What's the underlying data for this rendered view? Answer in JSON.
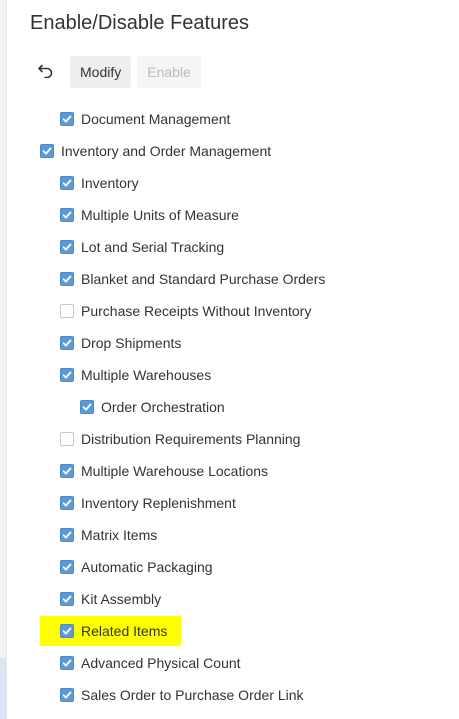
{
  "page": {
    "title": "Enable/Disable Features"
  },
  "toolbar": {
    "undo_icon": "undo-icon",
    "modify_label": "Modify",
    "enable_label": "Enable"
  },
  "colors": {
    "checkbox_checked": "#5b9bd5",
    "highlight": "#ffff00"
  },
  "features": [
    {
      "label": "Document Management",
      "checked": true,
      "level": 1
    },
    {
      "label": "Inventory and Order Management",
      "checked": true,
      "level": 0
    },
    {
      "label": "Inventory",
      "checked": true,
      "level": 1
    },
    {
      "label": "Multiple Units of Measure",
      "checked": true,
      "level": 1
    },
    {
      "label": "Lot and Serial Tracking",
      "checked": true,
      "level": 1
    },
    {
      "label": "Blanket and Standard Purchase Orders",
      "checked": true,
      "level": 1
    },
    {
      "label": "Purchase Receipts Without Inventory",
      "checked": false,
      "level": 1
    },
    {
      "label": "Drop Shipments",
      "checked": true,
      "level": 1
    },
    {
      "label": "Multiple Warehouses",
      "checked": true,
      "level": 1
    },
    {
      "label": "Order Orchestration",
      "checked": true,
      "level": 2
    },
    {
      "label": "Distribution Requirements Planning",
      "checked": false,
      "level": 1
    },
    {
      "label": "Multiple Warehouse Locations",
      "checked": true,
      "level": 1
    },
    {
      "label": "Inventory Replenishment",
      "checked": true,
      "level": 1
    },
    {
      "label": "Matrix Items",
      "checked": true,
      "level": 1
    },
    {
      "label": "Automatic Packaging",
      "checked": true,
      "level": 1
    },
    {
      "label": "Kit Assembly",
      "checked": true,
      "level": 1
    },
    {
      "label": "Related Items",
      "checked": true,
      "level": 1,
      "highlighted": true
    },
    {
      "label": "Advanced Physical Count",
      "checked": true,
      "level": 1
    },
    {
      "label": "Sales Order to Purchase Order Link",
      "checked": true,
      "level": 1
    }
  ]
}
